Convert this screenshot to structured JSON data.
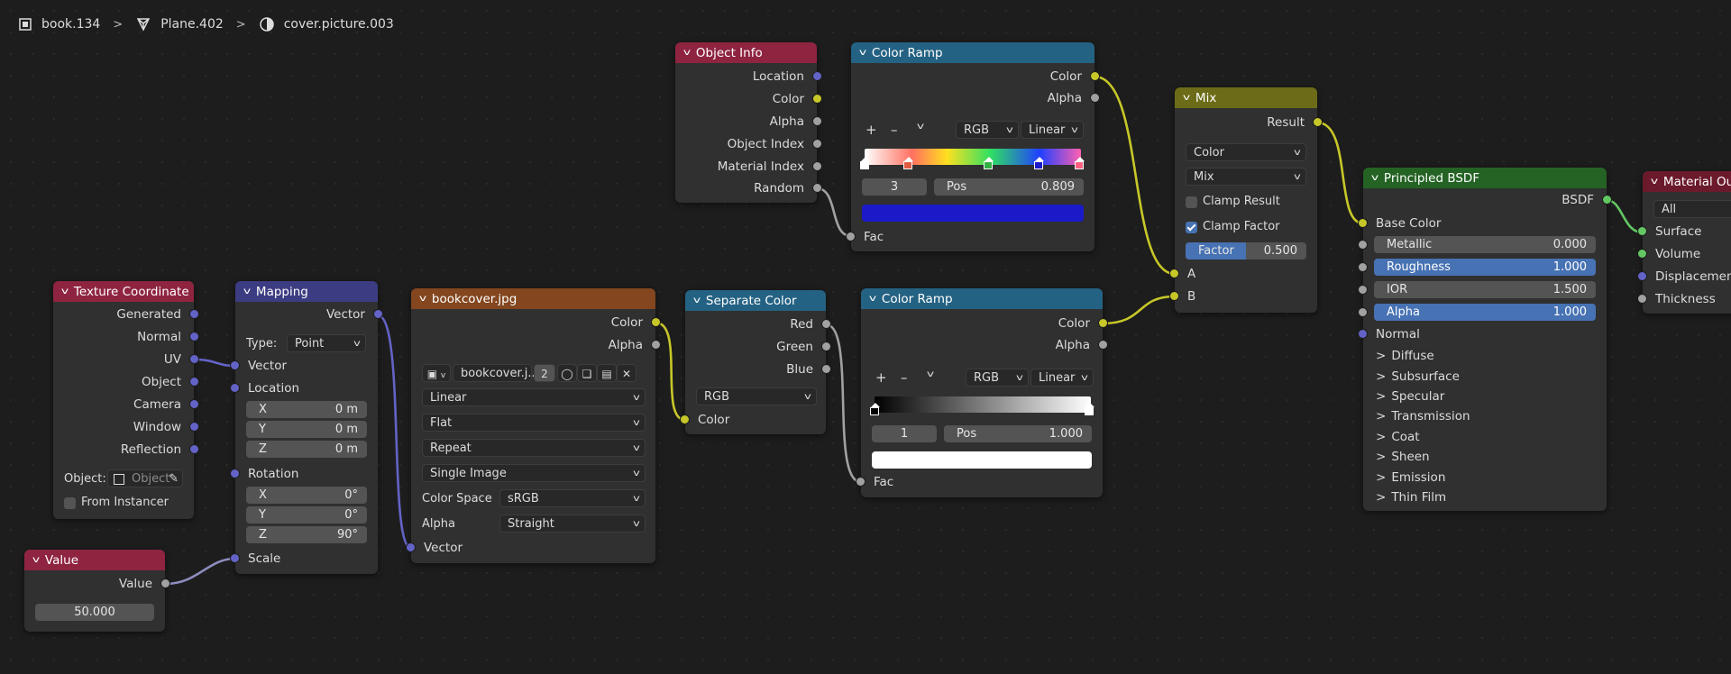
{
  "breadcrumb": {
    "object": "book.134",
    "mesh": "Plane.402",
    "material": "cover.picture.003"
  },
  "nodes": {
    "texcoord": {
      "title": "Texture Coordinate",
      "outputs": [
        "Generated",
        "Normal",
        "UV",
        "Object",
        "Camera",
        "Window",
        "Reflection"
      ],
      "object_label": "Object:",
      "object_placeholder": "Object",
      "from_instancer": "From Instancer"
    },
    "mapping": {
      "title": "Mapping",
      "output": "Vector",
      "type_label": "Type:",
      "type_value": "Point",
      "vector": "Vector",
      "location": "Location",
      "loc": [
        [
          "X",
          "0 m"
        ],
        [
          "Y",
          "0 m"
        ],
        [
          "Z",
          "0 m"
        ]
      ],
      "rotation": "Rotation",
      "rot": [
        [
          "X",
          "0°"
        ],
        [
          "Y",
          "0°"
        ],
        [
          "Z",
          "90°"
        ]
      ],
      "scale": "Scale"
    },
    "value": {
      "title": "Value",
      "output": "Value",
      "val": "50.000"
    },
    "image": {
      "title": "bookcover.jpg",
      "out_color": "Color",
      "out_alpha": "Alpha",
      "image_name": "bookcover.j...",
      "users": "2",
      "interp": "Linear",
      "proj": "Flat",
      "ext": "Repeat",
      "source": "Single Image",
      "cs_label": "Color Space",
      "cs_value": "sRGB",
      "alpha_label": "Alpha",
      "alpha_value": "Straight",
      "in_vector": "Vector"
    },
    "objinfo": {
      "title": "Object Info",
      "outputs": [
        "Location",
        "Color",
        "Alpha",
        "Object Index",
        "Material Index",
        "Random"
      ]
    },
    "ramp1": {
      "title": "Color Ramp",
      "out_color": "Color",
      "out_alpha": "Alpha",
      "mode": "RGB",
      "interp": "Linear",
      "index": "3",
      "pos_label": "Pos",
      "pos_value": "0.809",
      "in_fac": "Fac",
      "active_color": "#1a1ac8"
    },
    "sepcolor": {
      "title": "Separate Color",
      "outputs": [
        "Red",
        "Green",
        "Blue"
      ],
      "mode": "RGB",
      "in_color": "Color"
    },
    "ramp2": {
      "title": "Color Ramp",
      "out_color": "Color",
      "out_alpha": "Alpha",
      "mode": "RGB",
      "interp": "Linear",
      "index": "1",
      "pos_label": "Pos",
      "pos_value": "1.000",
      "in_fac": "Fac",
      "active_color": "#ffffff"
    },
    "mix": {
      "title": "Mix",
      "output": "Result",
      "data_type": "Color",
      "blend": "Mix",
      "clamp_result": "Clamp Result",
      "clamp_factor": "Clamp Factor",
      "factor_label": "Factor",
      "factor_value": "0.500",
      "in_a": "A",
      "in_b": "B"
    },
    "bsdf": {
      "title": "Principled BSDF",
      "output": "BSDF",
      "base_color": "Base Color",
      "fields": [
        [
          "Metallic",
          "0.000"
        ],
        [
          "Roughness",
          "1.000"
        ],
        [
          "IOR",
          "1.500"
        ],
        [
          "Alpha",
          "1.000"
        ]
      ],
      "normal": "Normal",
      "panels": [
        "Diffuse",
        "Subsurface",
        "Specular",
        "Transmission",
        "Coat",
        "Sheen",
        "Emission",
        "Thin Film"
      ]
    },
    "matout": {
      "title": "Material Out",
      "target": "All",
      "inputs": [
        "Surface",
        "Volume",
        "Displacement",
        "Thickness"
      ]
    }
  },
  "colors": {
    "attribute_header": "#8e2440",
    "input_header": "#8e2440",
    "vector_header": "#3c3c83",
    "texture_header": "#83461e",
    "converter_header": "#246283",
    "color_header": "#6c6c18",
    "shader_header": "#246324",
    "output_header": "#6b1a2b"
  }
}
